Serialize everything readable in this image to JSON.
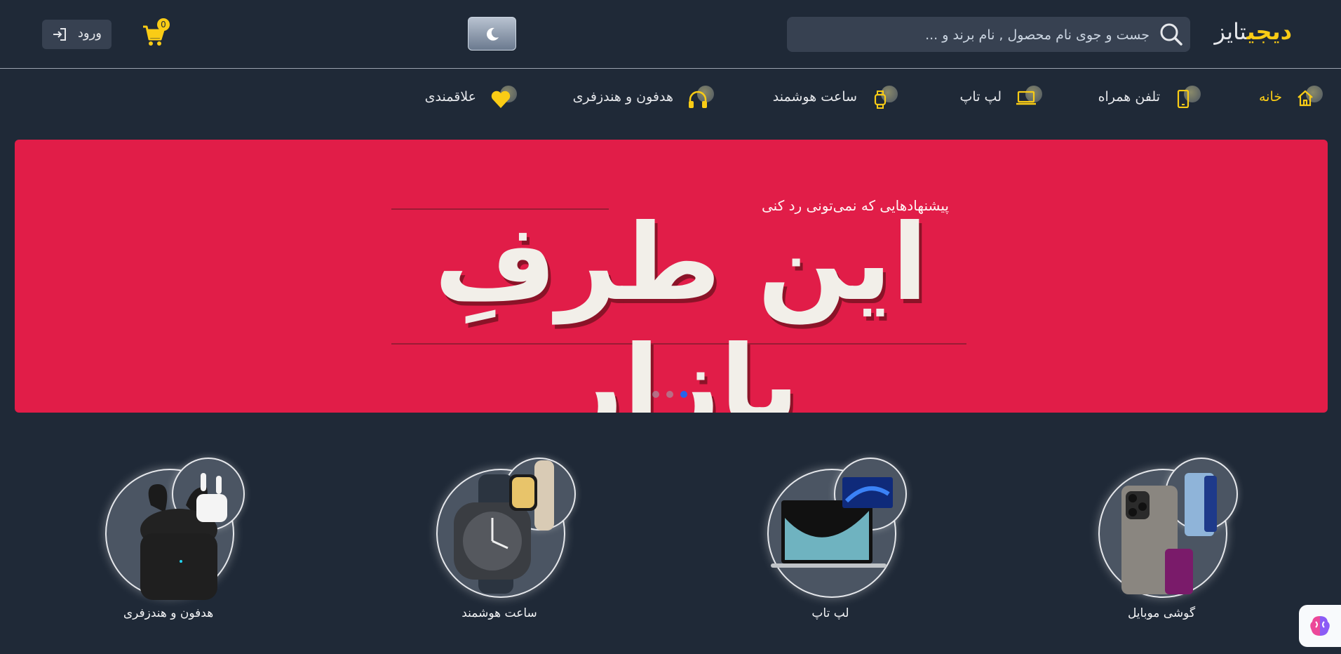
{
  "header": {
    "logo_part1": "دیجی",
    "logo_part2": "تایز",
    "search_placeholder": "جست و جوی نام محصول , نام برند و ...",
    "cart_count": "0",
    "login_label": "ورود"
  },
  "nav": {
    "items": [
      {
        "label": "خانه",
        "icon": "home-icon",
        "active": true
      },
      {
        "label": "تلفن همراه",
        "icon": "phone-icon"
      },
      {
        "label": "لپ تاپ",
        "icon": "laptop-icon"
      },
      {
        "label": "ساعت هوشمند",
        "icon": "watch-icon"
      },
      {
        "label": "هدفون و هندزفری",
        "icon": "headphones-icon"
      },
      {
        "label": "علاقمندی",
        "icon": "heart-icon"
      }
    ]
  },
  "banner": {
    "subtitle": "پیشنهادهایی که نمی‌تونی رد کنی",
    "headline": "این طرفِ بازار",
    "slides": 3,
    "active_slide": 3
  },
  "categories": [
    {
      "label": "گوشی موبایل"
    },
    {
      "label": "لپ تاپ"
    },
    {
      "label": "ساعت هوشمند"
    },
    {
      "label": "هدفون و هندزفری"
    }
  ],
  "colors": {
    "background": "#1f2937",
    "accent": "#facc15",
    "banner": "#e11d48",
    "slider_active": "#2563eb"
  }
}
